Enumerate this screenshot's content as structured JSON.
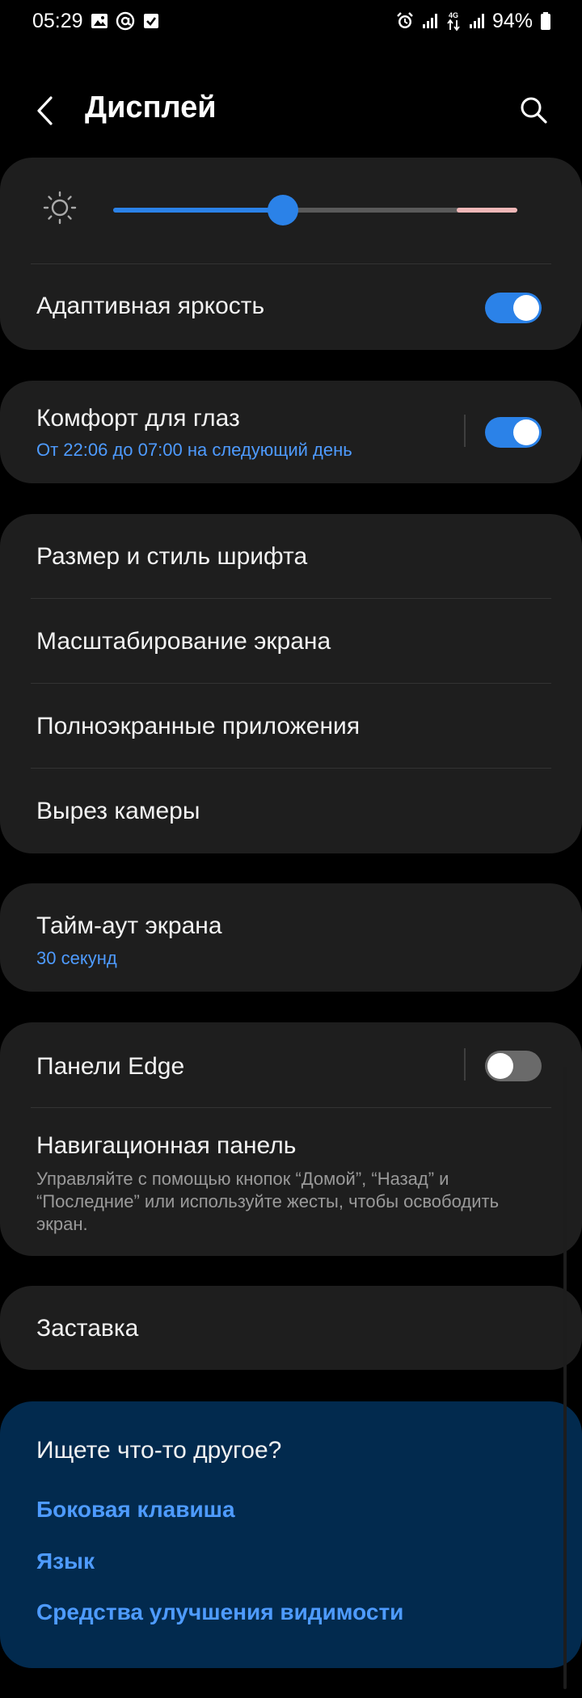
{
  "status_bar": {
    "time": "05:29",
    "notification_icons": [
      "image-icon",
      "at-sign-icon",
      "checkbox-icon"
    ],
    "right_icons": [
      "alarm-icon",
      "signal-icon",
      "4g-data-icon",
      "signal-icon"
    ],
    "network_label": "4G",
    "battery_percent": "94%"
  },
  "header": {
    "title": "Дисплей"
  },
  "brightness": {
    "level": 0.42,
    "icon": "brightness-icon"
  },
  "adaptive_brightness": {
    "label": "Адаптивная яркость",
    "enabled": true
  },
  "eye_comfort": {
    "label": "Комфорт для глаз",
    "schedule": "От 22:06 до 07:00 на следующий день",
    "enabled": true
  },
  "display_options": {
    "items": [
      {
        "label": "Размер и стиль шрифта"
      },
      {
        "label": "Масштабирование экрана"
      },
      {
        "label": "Полноэкранные приложения"
      },
      {
        "label": "Вырез камеры"
      }
    ]
  },
  "screen_timeout": {
    "label": "Тайм-аут экрана",
    "value": "30 секунд"
  },
  "edge_panels": {
    "label": "Панели Edge",
    "enabled": false
  },
  "navigation_bar": {
    "label": "Навигационная панель",
    "description": "Управляйте с помощью кнопок “Домой”, “Назад” и “Последние” или используйте жесты, чтобы освободить экран."
  },
  "screensaver": {
    "label": "Заставка"
  },
  "suggestions": {
    "title": "Ищете что-то другое?",
    "links": [
      {
        "label": "Боковая клавиша"
      },
      {
        "label": "Язык"
      },
      {
        "label": "Средства улучшения видимости"
      }
    ]
  },
  "colors": {
    "accent": "#2b82e8",
    "link": "#4e9bff",
    "card": "#1e1e1e",
    "suggest_bg": "#022a4e"
  }
}
